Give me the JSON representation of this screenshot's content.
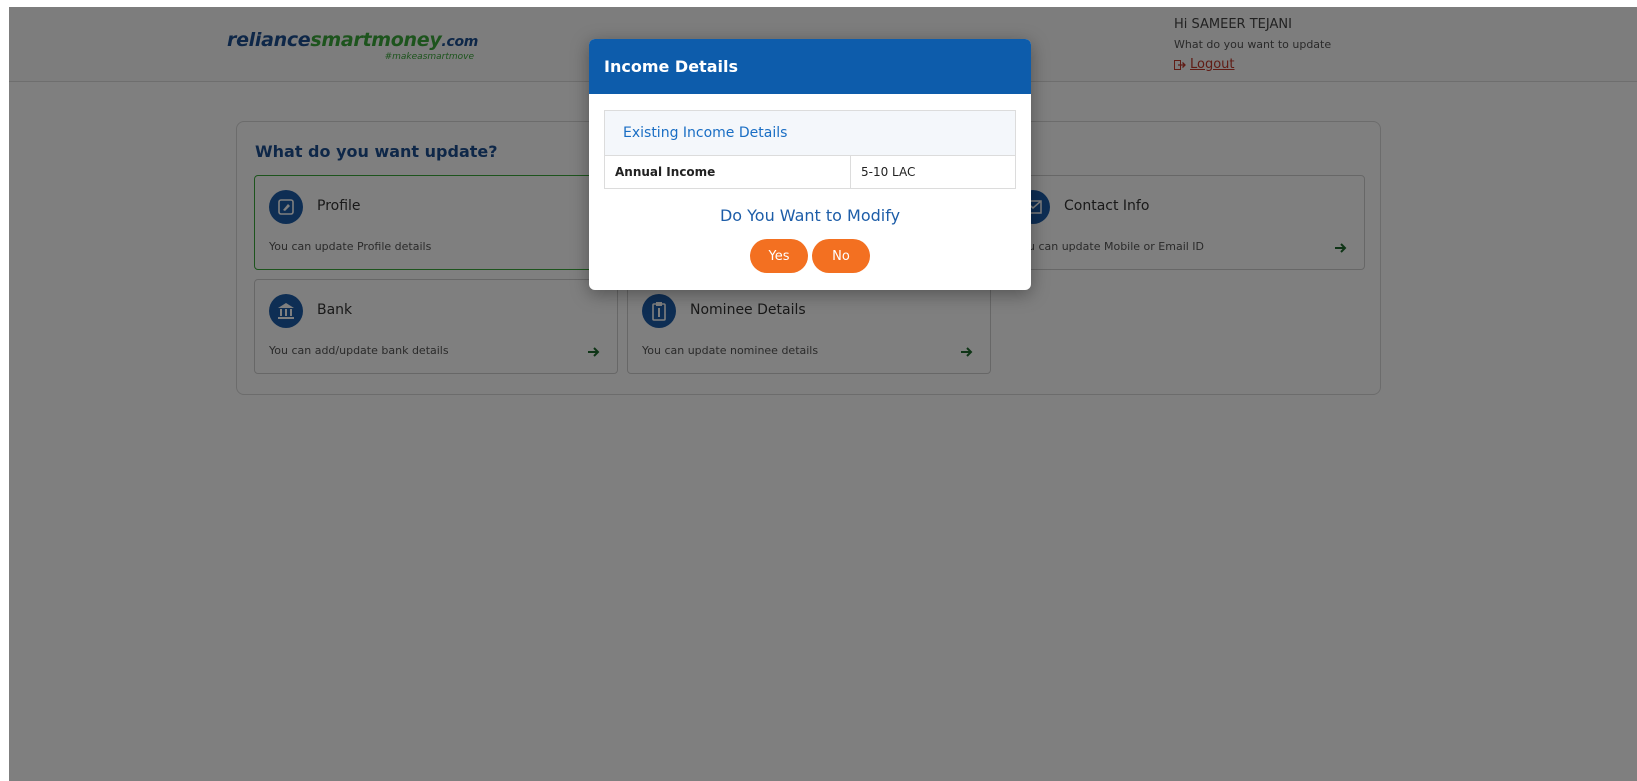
{
  "logo": {
    "part1": "reliance",
    "part2": "smartmoney",
    "part3": ".com",
    "tagline": "#makeasmartmove"
  },
  "user": {
    "greeting": "Hi SAMEER TEJANI",
    "subtitle": "What do you want to update",
    "logout_label": "Logout"
  },
  "panel": {
    "title": "What do you want update?",
    "cards": [
      {
        "title": "Profile",
        "description": "You can update Profile details",
        "icon": "profile-icon"
      },
      {
        "title": "Contact Info",
        "description": "You can update Mobile or Email ID",
        "icon": "mail-icon"
      },
      {
        "title": "Bank",
        "description": "You can add/update bank details",
        "icon": "bank-icon"
      },
      {
        "title": "Nominee Details",
        "description": "You can update nominee details",
        "icon": "clipboard-icon"
      }
    ]
  },
  "modal": {
    "title": "Income Details",
    "table_header": "Existing Income Details",
    "rows": [
      {
        "label": "Annual Income",
        "value": "5-10 LAC"
      }
    ],
    "question": "Do You Want to Modify",
    "yes_label": "Yes",
    "no_label": "No"
  },
  "colors": {
    "brand_blue": "#0d5cab",
    "brand_green": "#3aa83a",
    "accent_orange": "#f37021",
    "logout_red": "#c0392b"
  }
}
